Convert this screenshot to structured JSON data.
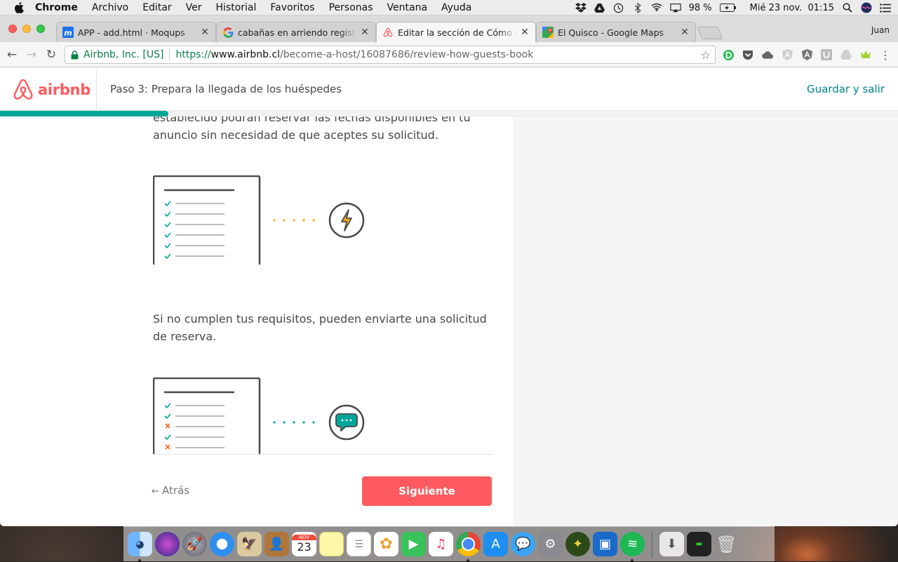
{
  "menubar": {
    "app_name": "Chrome",
    "items": [
      "Archivo",
      "Editar",
      "Ver",
      "Historial",
      "Favoritos",
      "Personas",
      "Ventana",
      "Ayuda"
    ],
    "battery": "98 %",
    "datetime": "Mié 23 nov.  01:15"
  },
  "browser": {
    "tabs": [
      {
        "title": "APP - add.html · Moqups",
        "icon": "moqups-icon"
      },
      {
        "title": "cabañas en arriendo registor - ",
        "icon": "google-icon"
      },
      {
        "title": "Editar la sección de Cómo reser",
        "icon": "airbnb-icon"
      },
      {
        "title": "El Quisco - Google Maps",
        "icon": "maps-icon"
      }
    ],
    "profile_name": "Juan",
    "security_label": "Airbnb, Inc. [US]",
    "url_scheme": "https://",
    "url_host": "www.airbnb.cl",
    "url_path": "/become-a-host/16087686/review-how-guests-book"
  },
  "site": {
    "logo_text": "airbnb",
    "step_title": "Paso 3: Prepara la llegada de los huéspedes",
    "save_label": "Guardar y salir",
    "progress_fraction": 0.1875,
    "content": {
      "cut_line_1": "establecido podrán reservar las fechas disponibles en tu",
      "cut_line_2": "anuncio sin necesidad de que aceptes su solicitud.",
      "paragraph_2": "Si no cumplen tus requisitos, pueden enviarte una solicitud de reserva."
    },
    "footer": {
      "back_label": "Atrás",
      "next_label": "Siguiente"
    },
    "colors": {
      "brand": "#ff5a5f",
      "teal": "#00a699",
      "link": "#008489",
      "lightning": "#f5a623"
    }
  },
  "dock": {
    "calendar_month": "NOV",
    "calendar_day": "23"
  }
}
